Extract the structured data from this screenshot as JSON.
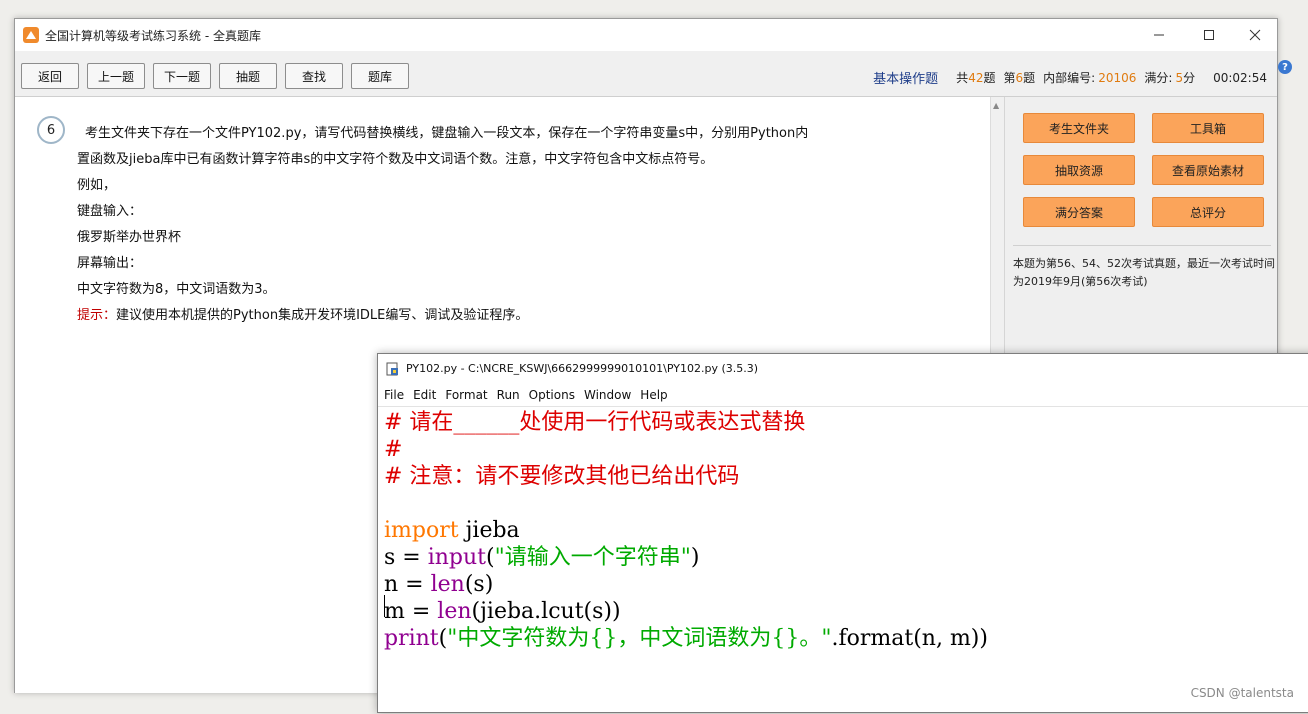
{
  "exam_window": {
    "title": "全国计算机等级考试练习系统 - 全真题库",
    "toolbar": {
      "buttons": [
        "返回",
        "上一题",
        "下一题",
        "抽题",
        "查找",
        "题库"
      ]
    },
    "status": {
      "category": "基本操作题",
      "total_prefix": "共",
      "total": "42",
      "total_suffix": "题",
      "index_prefix": "第",
      "index": "6",
      "index_suffix": "题",
      "code_label": "内部编号:",
      "code": "20106",
      "score_label": "满分:",
      "score": "5",
      "score_suffix": "分",
      "timer": "00:02:54"
    },
    "question": {
      "number": "6",
      "lines": [
        "考生文件夹下存在一个文件PY102.py，请写代码替换横线，键盘输入一段文本，保存在一个字符串变量s中，分别用Python内",
        "置函数及jieba库中已有函数计算字符串s的中文字符个数及中文词语个数。注意，中文字符包含中文标点符号。",
        "例如，",
        "键盘输入：",
        "俄罗斯举办世界杯",
        "屏幕输出：",
        "中文字符数为8，中文词语数为3。"
      ],
      "hint_label": "提示：",
      "hint_text": "建议使用本机提供的Python集成开发环境IDLE编写、调试及验证程序。"
    },
    "panel": {
      "buttons": [
        "考生文件夹",
        "工具箱",
        "抽取资源",
        "查看原始素材",
        "满分答案",
        "总评分"
      ],
      "note": "本题为第56、54、52次考试真题，最近一次考试时间为2019年9月(第56次考试)"
    }
  },
  "idle_window": {
    "title": "PY102.py - C:\\NCRE_KSWJ\\6662999999010101\\PY102.py (3.5.3)",
    "menu": [
      "File",
      "Edit",
      "Format",
      "Run",
      "Options",
      "Window",
      "Help"
    ],
    "code": {
      "l1": "# 请在______处使用一行代码或表达式替换",
      "l2": "#",
      "l3": "# 注意：请不要修改其他已给出代码",
      "l5_kw": "import",
      "l5_rest": " jieba",
      "l6_a": "s = ",
      "l6_fn": "input",
      "l6_b": "(",
      "l6_str": "\"请输入一个字符串\"",
      "l6_c": ")",
      "l7_a": "n = ",
      "l7_fn": "len",
      "l7_b": "(s)",
      "l8_a": "m = ",
      "l8_fn": "len",
      "l8_b": "(jieba.lcut(s))",
      "l9_fn": "print",
      "l9_a": "(",
      "l9_str": "\"中文字符数为{}，中文词语数为{}。\"",
      "l9_b": ".format(n, m))"
    }
  },
  "watermark": "CSDN @talentsta",
  "colors": {
    "accent_orange": "#fba45a",
    "status_blue": "#1f3e8a",
    "status_orange": "#e07b10",
    "hint_red": "#c00000"
  }
}
